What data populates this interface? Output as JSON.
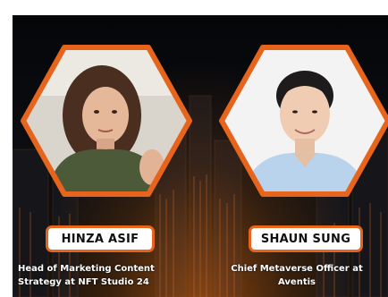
{
  "colors": {
    "accent": "#e6641b",
    "background": "#07080b",
    "text": "#ffffff",
    "pill_background": "#ffffff",
    "pill_text": "#101010"
  },
  "speakers": [
    {
      "name": "HINZA ASIF",
      "role_line_1": "Head of Marketing Content",
      "role_line_2": "Strategy  at NFT Studio 24",
      "photo_icon": "person-portrait-icon"
    },
    {
      "name": "SHAUN SUNG",
      "role_line_1": "Chief Metaverse Officer at",
      "role_line_2": "Aventis",
      "photo_icon": "person-portrait-icon"
    }
  ]
}
